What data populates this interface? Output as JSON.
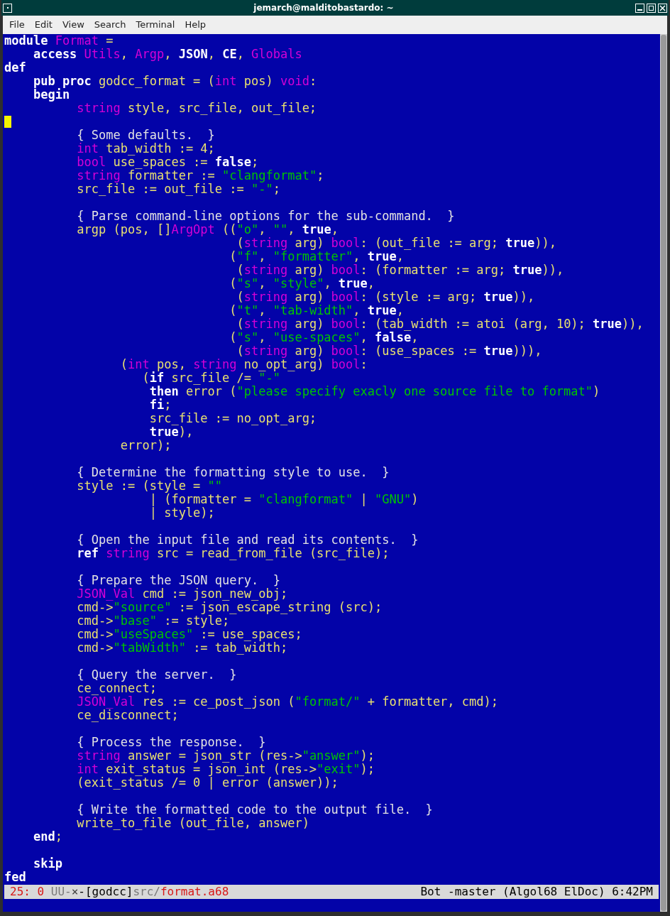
{
  "window": {
    "title": "jemarch@malditobastardo: ~"
  },
  "menu": [
    "File",
    "Edit",
    "View",
    "Search",
    "Terminal",
    "Help"
  ],
  "buffer": {
    "lines": [
      {
        "cursor": false,
        "segments": [
          {
            "kind": "keyword",
            "text": "module "
          },
          {
            "kind": "type",
            "text": "Format"
          },
          {
            "kind": "name",
            "text": " ="
          }
        ]
      },
      {
        "cursor": false,
        "segments": [
          {
            "kind": "keyword",
            "text": "    access "
          },
          {
            "kind": "type",
            "text": "Utils"
          },
          {
            "kind": "name",
            "text": ", "
          },
          {
            "kind": "type",
            "text": "Argp"
          },
          {
            "kind": "name",
            "text": ", "
          },
          {
            "kind": "keyword",
            "text": "JSON"
          },
          {
            "kind": "name",
            "text": ", "
          },
          {
            "kind": "keyword",
            "text": "CE"
          },
          {
            "kind": "name",
            "text": ", "
          },
          {
            "kind": "type",
            "text": "Globals"
          }
        ]
      },
      {
        "cursor": false,
        "segments": [
          {
            "kind": "keyword",
            "text": "def"
          }
        ]
      },
      {
        "cursor": false,
        "segments": [
          {
            "kind": "keyword",
            "text": "    pub proc "
          },
          {
            "kind": "name",
            "text": "godcc_format = ("
          },
          {
            "kind": "type",
            "text": "int"
          },
          {
            "kind": "name",
            "text": " pos) "
          },
          {
            "kind": "type",
            "text": "void"
          },
          {
            "kind": "name",
            "text": ":"
          }
        ]
      },
      {
        "cursor": false,
        "segments": [
          {
            "kind": "keyword",
            "text": "    begin"
          }
        ]
      },
      {
        "cursor": false,
        "segments": [
          {
            "kind": "type",
            "text": "          string"
          },
          {
            "kind": "name",
            "text": " style, src_file, out_file;"
          }
        ]
      },
      {
        "cursor": true
      },
      {
        "cursor": false,
        "segments": [
          {
            "kind": "comment",
            "text": "          { Some defaults.  }"
          }
        ]
      },
      {
        "cursor": false,
        "segments": [
          {
            "kind": "type",
            "text": "          int"
          },
          {
            "kind": "name",
            "text": " tab_width := 4;"
          }
        ]
      },
      {
        "cursor": false,
        "segments": [
          {
            "kind": "type",
            "text": "          bool"
          },
          {
            "kind": "name",
            "text": " use_spaces := "
          },
          {
            "kind": "keyword",
            "text": "false"
          },
          {
            "kind": "name",
            "text": ";"
          }
        ]
      },
      {
        "cursor": false,
        "segments": [
          {
            "kind": "type",
            "text": "          string"
          },
          {
            "kind": "name",
            "text": " formatter := "
          },
          {
            "kind": "string",
            "text": "\"clangformat\""
          },
          {
            "kind": "name",
            "text": ";"
          }
        ]
      },
      {
        "cursor": false,
        "segments": [
          {
            "kind": "name",
            "text": "          src_file := out_file := "
          },
          {
            "kind": "string",
            "text": "\"-\""
          },
          {
            "kind": "name",
            "text": ";"
          }
        ]
      },
      {
        "cursor": false
      },
      {
        "cursor": false,
        "segments": [
          {
            "kind": "comment",
            "text": "          { Parse command-line options for the sub-command.  }"
          }
        ]
      },
      {
        "cursor": false,
        "segments": [
          {
            "kind": "name",
            "text": "          argp (pos, []"
          },
          {
            "kind": "type",
            "text": "ArgOpt"
          },
          {
            "kind": "name",
            "text": " (("
          },
          {
            "kind": "string",
            "text": "\"o\""
          },
          {
            "kind": "name",
            "text": ", "
          },
          {
            "kind": "string",
            "text": "\"\""
          },
          {
            "kind": "name",
            "text": ", "
          },
          {
            "kind": "keyword",
            "text": "true"
          },
          {
            "kind": "name",
            "text": ","
          }
        ]
      },
      {
        "cursor": false,
        "segments": [
          {
            "kind": "name",
            "text": "                                ("
          },
          {
            "kind": "type",
            "text": "string"
          },
          {
            "kind": "name",
            "text": " arg) "
          },
          {
            "kind": "type",
            "text": "bool"
          },
          {
            "kind": "name",
            "text": ": (out_file := arg; "
          },
          {
            "kind": "keyword",
            "text": "true"
          },
          {
            "kind": "name",
            "text": ")),"
          }
        ]
      },
      {
        "cursor": false,
        "segments": [
          {
            "kind": "name",
            "text": "                               ("
          },
          {
            "kind": "string",
            "text": "\"f\""
          },
          {
            "kind": "name",
            "text": ", "
          },
          {
            "kind": "string",
            "text": "\"formatter\""
          },
          {
            "kind": "name",
            "text": ", "
          },
          {
            "kind": "keyword",
            "text": "true"
          },
          {
            "kind": "name",
            "text": ","
          }
        ]
      },
      {
        "cursor": false,
        "segments": [
          {
            "kind": "name",
            "text": "                                ("
          },
          {
            "kind": "type",
            "text": "string"
          },
          {
            "kind": "name",
            "text": " arg) "
          },
          {
            "kind": "type",
            "text": "bool"
          },
          {
            "kind": "name",
            "text": ": (formatter := arg; "
          },
          {
            "kind": "keyword",
            "text": "true"
          },
          {
            "kind": "name",
            "text": ")),"
          }
        ]
      },
      {
        "cursor": false,
        "segments": [
          {
            "kind": "name",
            "text": "                               ("
          },
          {
            "kind": "string",
            "text": "\"s\""
          },
          {
            "kind": "name",
            "text": ", "
          },
          {
            "kind": "string",
            "text": "\"style\""
          },
          {
            "kind": "name",
            "text": ", "
          },
          {
            "kind": "keyword",
            "text": "true"
          },
          {
            "kind": "name",
            "text": ","
          }
        ]
      },
      {
        "cursor": false,
        "segments": [
          {
            "kind": "name",
            "text": "                                ("
          },
          {
            "kind": "type",
            "text": "string"
          },
          {
            "kind": "name",
            "text": " arg) "
          },
          {
            "kind": "type",
            "text": "bool"
          },
          {
            "kind": "name",
            "text": ": (style := arg; "
          },
          {
            "kind": "keyword",
            "text": "true"
          },
          {
            "kind": "name",
            "text": ")),"
          }
        ]
      },
      {
        "cursor": false,
        "segments": [
          {
            "kind": "name",
            "text": "                               ("
          },
          {
            "kind": "string",
            "text": "\"t\""
          },
          {
            "kind": "name",
            "text": ", "
          },
          {
            "kind": "string",
            "text": "\"tab-width\""
          },
          {
            "kind": "name",
            "text": ", "
          },
          {
            "kind": "keyword",
            "text": "true"
          },
          {
            "kind": "name",
            "text": ","
          }
        ]
      },
      {
        "cursor": false,
        "segments": [
          {
            "kind": "name",
            "text": "                                ("
          },
          {
            "kind": "type",
            "text": "string"
          },
          {
            "kind": "name",
            "text": " arg) "
          },
          {
            "kind": "type",
            "text": "bool"
          },
          {
            "kind": "name",
            "text": ": (tab_width := atoi (arg, 10); "
          },
          {
            "kind": "keyword",
            "text": "true"
          },
          {
            "kind": "name",
            "text": ")),"
          }
        ]
      },
      {
        "cursor": false,
        "segments": [
          {
            "kind": "name",
            "text": "                               ("
          },
          {
            "kind": "string",
            "text": "\"s\""
          },
          {
            "kind": "name",
            "text": ", "
          },
          {
            "kind": "string",
            "text": "\"use-spaces\""
          },
          {
            "kind": "name",
            "text": ", "
          },
          {
            "kind": "keyword",
            "text": "false"
          },
          {
            "kind": "name",
            "text": ","
          }
        ]
      },
      {
        "cursor": false,
        "segments": [
          {
            "kind": "name",
            "text": "                                ("
          },
          {
            "kind": "type",
            "text": "string"
          },
          {
            "kind": "name",
            "text": " arg) "
          },
          {
            "kind": "type",
            "text": "bool"
          },
          {
            "kind": "name",
            "text": ": (use_spaces := "
          },
          {
            "kind": "keyword",
            "text": "true"
          },
          {
            "kind": "name",
            "text": "))),"
          }
        ]
      },
      {
        "cursor": false,
        "segments": [
          {
            "kind": "name",
            "text": "                ("
          },
          {
            "kind": "type",
            "text": "int"
          },
          {
            "kind": "name",
            "text": " pos, "
          },
          {
            "kind": "type",
            "text": "string"
          },
          {
            "kind": "name",
            "text": " no_opt_arg) "
          },
          {
            "kind": "type",
            "text": "bool"
          },
          {
            "kind": "name",
            "text": ":"
          }
        ]
      },
      {
        "cursor": false,
        "segments": [
          {
            "kind": "name",
            "text": "                   ("
          },
          {
            "kind": "keyword",
            "text": "if"
          },
          {
            "kind": "name",
            "text": " src_file /= "
          },
          {
            "kind": "string",
            "text": "\"-\""
          }
        ]
      },
      {
        "cursor": false,
        "segments": [
          {
            "kind": "keyword",
            "text": "                    then"
          },
          {
            "kind": "name",
            "text": " error ("
          },
          {
            "kind": "string",
            "text": "\"please specify exacly one source file to format\""
          },
          {
            "kind": "name",
            "text": ")"
          }
        ]
      },
      {
        "cursor": false,
        "segments": [
          {
            "kind": "keyword",
            "text": "                    fi"
          },
          {
            "kind": "name",
            "text": ";"
          }
        ]
      },
      {
        "cursor": false,
        "segments": [
          {
            "kind": "name",
            "text": "                    src_file := no_opt_arg;"
          }
        ]
      },
      {
        "cursor": false,
        "segments": [
          {
            "kind": "keyword",
            "text": "                    true"
          },
          {
            "kind": "name",
            "text": "),"
          }
        ]
      },
      {
        "cursor": false,
        "segments": [
          {
            "kind": "name",
            "text": "                error);"
          }
        ]
      },
      {
        "cursor": false
      },
      {
        "cursor": false,
        "segments": [
          {
            "kind": "comment",
            "text": "          { Determine the formatting style to use.  }"
          }
        ]
      },
      {
        "cursor": false,
        "segments": [
          {
            "kind": "name",
            "text": "          style := (style = "
          },
          {
            "kind": "string",
            "text": "\"\""
          }
        ]
      },
      {
        "cursor": false,
        "segments": [
          {
            "kind": "name",
            "text": "                    | (formatter = "
          },
          {
            "kind": "string",
            "text": "\"clangformat\""
          },
          {
            "kind": "name",
            "text": " | "
          },
          {
            "kind": "string",
            "text": "\"GNU\""
          },
          {
            "kind": "name",
            "text": ")"
          }
        ]
      },
      {
        "cursor": false,
        "segments": [
          {
            "kind": "name",
            "text": "                    | style);"
          }
        ]
      },
      {
        "cursor": false
      },
      {
        "cursor": false,
        "segments": [
          {
            "kind": "comment",
            "text": "          { Open the input file and read its contents.  }"
          }
        ]
      },
      {
        "cursor": false,
        "segments": [
          {
            "kind": "keyword",
            "text": "          ref "
          },
          {
            "kind": "type",
            "text": "string"
          },
          {
            "kind": "name",
            "text": " src = read_from_file (src_file);"
          }
        ]
      },
      {
        "cursor": false
      },
      {
        "cursor": false,
        "segments": [
          {
            "kind": "comment",
            "text": "          { Prepare the JSON query.  }"
          }
        ]
      },
      {
        "cursor": false,
        "segments": [
          {
            "kind": "type",
            "text": "          JSON_Val"
          },
          {
            "kind": "name",
            "text": " cmd := json_new_obj;"
          }
        ]
      },
      {
        "cursor": false,
        "segments": [
          {
            "kind": "name",
            "text": "          cmd->"
          },
          {
            "kind": "string",
            "text": "\"source\""
          },
          {
            "kind": "name",
            "text": " := json_escape_string (src);"
          }
        ]
      },
      {
        "cursor": false,
        "segments": [
          {
            "kind": "name",
            "text": "          cmd->"
          },
          {
            "kind": "string",
            "text": "\"base\""
          },
          {
            "kind": "name",
            "text": " := style;"
          }
        ]
      },
      {
        "cursor": false,
        "segments": [
          {
            "kind": "name",
            "text": "          cmd->"
          },
          {
            "kind": "string",
            "text": "\"useSpaces\""
          },
          {
            "kind": "name",
            "text": " := use_spaces;"
          }
        ]
      },
      {
        "cursor": false,
        "segments": [
          {
            "kind": "name",
            "text": "          cmd->"
          },
          {
            "kind": "string",
            "text": "\"tabWidth\""
          },
          {
            "kind": "name",
            "text": " := tab_width;"
          }
        ]
      },
      {
        "cursor": false
      },
      {
        "cursor": false,
        "segments": [
          {
            "kind": "comment",
            "text": "          { Query the server.  }"
          }
        ]
      },
      {
        "cursor": false,
        "segments": [
          {
            "kind": "name",
            "text": "          ce_connect;"
          }
        ]
      },
      {
        "cursor": false,
        "segments": [
          {
            "kind": "type",
            "text": "          JSON_Val"
          },
          {
            "kind": "name",
            "text": " res := ce_post_json ("
          },
          {
            "kind": "string",
            "text": "\"format/\""
          },
          {
            "kind": "name",
            "text": " + formatter, cmd);"
          }
        ]
      },
      {
        "cursor": false,
        "segments": [
          {
            "kind": "name",
            "text": "          ce_disconnect;"
          }
        ]
      },
      {
        "cursor": false
      },
      {
        "cursor": false,
        "segments": [
          {
            "kind": "comment",
            "text": "          { Process the response.  }"
          }
        ]
      },
      {
        "cursor": false,
        "segments": [
          {
            "kind": "type",
            "text": "          string"
          },
          {
            "kind": "name",
            "text": " answer = json_str (res->"
          },
          {
            "kind": "string",
            "text": "\"answer\""
          },
          {
            "kind": "name",
            "text": ");"
          }
        ]
      },
      {
        "cursor": false,
        "segments": [
          {
            "kind": "type",
            "text": "          int"
          },
          {
            "kind": "name",
            "text": " exit_status = json_int (res->"
          },
          {
            "kind": "string",
            "text": "\"exit\""
          },
          {
            "kind": "name",
            "text": ");"
          }
        ]
      },
      {
        "cursor": false,
        "segments": [
          {
            "kind": "name",
            "text": "          (exit_status /= 0 | error (answer));"
          }
        ]
      },
      {
        "cursor": false
      },
      {
        "cursor": false,
        "segments": [
          {
            "kind": "comment",
            "text": "          { Write the formatted code to the output file.  }"
          }
        ]
      },
      {
        "cursor": false,
        "segments": [
          {
            "kind": "name",
            "text": "          write_to_file (out_file, answer)"
          }
        ]
      },
      {
        "cursor": false,
        "segments": [
          {
            "kind": "keyword",
            "text": "    end"
          },
          {
            "kind": "name",
            "text": ";"
          }
        ]
      },
      {
        "cursor": false
      },
      {
        "cursor": false,
        "segments": [
          {
            "kind": "keyword",
            "text": "    skip"
          }
        ]
      },
      {
        "cursor": false,
        "segments": [
          {
            "kind": "keyword",
            "text": "fed"
          }
        ]
      }
    ]
  },
  "mode_line": {
    "left": [
      {
        "kind": "alert",
        "text": "25: 0"
      },
      {
        "kind": "dim",
        "text": " UU-"
      },
      {
        "kind": "mark",
        "text": "×"
      },
      {
        "kind": "plain",
        "text": "-[godcc]"
      },
      {
        "kind": "dim",
        "text": "src/"
      },
      {
        "kind": "alert",
        "text": "format.a68"
      }
    ],
    "right": "Bot -master (Algol68 ElDoc) 6:42PM"
  }
}
